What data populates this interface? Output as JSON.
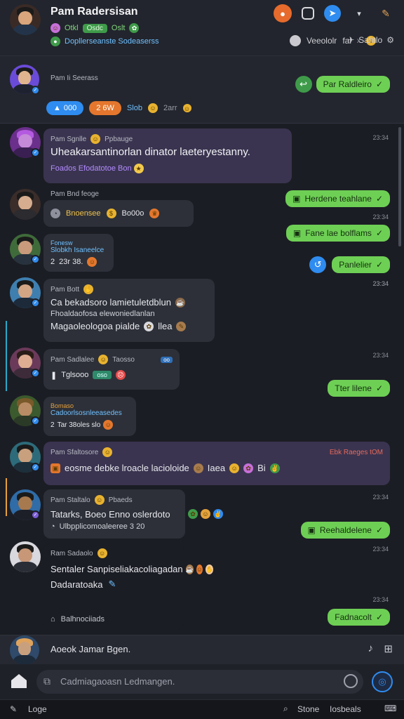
{
  "header": {
    "title": "Pam Radersisan",
    "row1": {
      "a": "Otkl",
      "tag": "Osdc",
      "b": "Oslt"
    },
    "row2": "Dopllerseanste Sodeaserss",
    "right_label": "Veeololr",
    "right_sep": "fal",
    "right_x": "x",
    "right_status": "Sahtlo"
  },
  "subhead": {
    "sender": "Pam Ii Seerass",
    "out_label": "Par Raldleiro",
    "pill1": "000",
    "pill2": "2 6W",
    "text3": "Slob",
    "text4": "2arr"
  },
  "messages": [
    {
      "sender": "Pam Sgnlle",
      "meta": "Ppbauge",
      "text": "Uheakarsantinorlan dinator laeteryestanny.",
      "sub": "Foados Efodatotoe Bon",
      "time": "23:34"
    },
    {
      "sender": "Pam Bnd feoge",
      "text": "Bnoensee",
      "num": "Bo00o",
      "time": "23:34"
    },
    {
      "sender": "Fonesw",
      "sub": "Slobkh Isaneelce",
      "num": "2",
      "num2": "23r 38.",
      "time": "23:34"
    },
    {
      "sender": "Pam Bott",
      "text": "Ca bekadsoro lamietuletdblun",
      "sub": "Fhoaldaofosa elewoniedlanlan",
      "text2": "Magaoleologoa pialde",
      "text3": "llea",
      "time": "23:34"
    },
    {
      "sender": "Pam Sadlalee",
      "meta": "Taosso",
      "text": "Tglsooo",
      "time": "23:34"
    },
    {
      "sender": "Bomaso",
      "sub": "Cadoorlsosnleeasedes",
      "num": "2",
      "num2": "Tar 38oles slo",
      "time": ""
    },
    {
      "sender": "Pam Sfaltosore",
      "meta": "Ebk Raeges tOM",
      "text": "eosme debke lroacle lacioloide",
      "tail": "Iaea",
      "tail2": "Bi",
      "time": ""
    },
    {
      "sender": "Pam Staltalo",
      "meta": "Pbaeds",
      "text": "Tatarks, Boeo Enno oslerdoto",
      "sub": "Ulbpplicomoaleeree 3 20",
      "time": "23:34"
    },
    {
      "sender": "Ram Sadaolo",
      "text": "Sentaler Sanpiseliakacoliagadan",
      "text2": "Dadaratoaka",
      "footer": "Balhnociiads",
      "time": "23:34"
    }
  ],
  "outgoing": [
    {
      "label": "Herdene teahlane",
      "time": "23:34"
    },
    {
      "label": "Fane lae bolflams",
      "time": ""
    },
    {
      "label": "Panlelier",
      "time": "23:34"
    },
    {
      "label": "Tter lilene",
      "time": "23:34"
    },
    {
      "label": "Reehaldelene",
      "time": "23:34"
    },
    {
      "label": "Fadnacolt",
      "time": ""
    }
  ],
  "inputbar": {
    "text": "Aoeok Jamar Bgen."
  },
  "composer": {
    "placeholder": "Cadmiagaoasn Ledmangen."
  },
  "statusbar": {
    "left": "Loge",
    "right1": "Stone",
    "right2": "Iosbeals"
  },
  "colors": {
    "accent_green": "#6ecf55",
    "accent_blue": "#2f8cf0",
    "bg": "#1b1d24"
  }
}
